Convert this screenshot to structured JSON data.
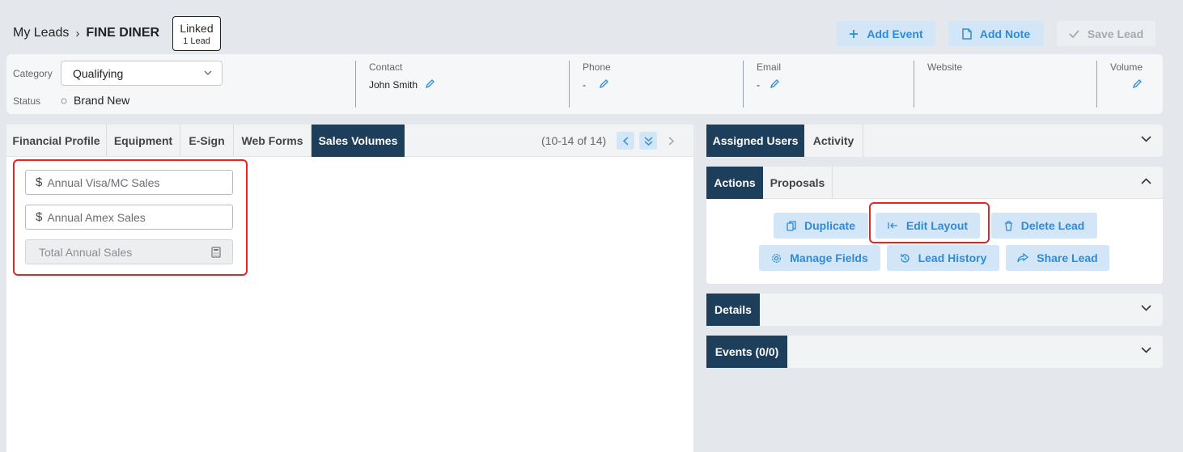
{
  "breadcrumb": {
    "root": "My Leads",
    "separator": "›",
    "current": "FINE DINER"
  },
  "linked_badge": {
    "title": "Linked",
    "count": "1 Lead"
  },
  "header_actions": {
    "add_event": "Add Event",
    "add_note": "Add Note",
    "save_lead": "Save Lead"
  },
  "info": {
    "category_label": "Category",
    "category_value": "Qualifying",
    "status_label": "Status",
    "status_value": "Brand New",
    "contact_label": "Contact",
    "contact_value": "John Smith",
    "phone_label": "Phone",
    "phone_value": "-",
    "email_label": "Email",
    "email_value": "-",
    "website_label": "Website",
    "volume_label": "Volume"
  },
  "left_tabs": [
    "Financial Profile",
    "Equipment",
    "E-Sign",
    "Web Forms",
    "Sales Volumes"
  ],
  "pager": {
    "text": "(10-14 of 14)"
  },
  "sales_fields": {
    "visa_mc_placeholder": "Annual Visa/MC Sales",
    "amex_placeholder": "Annual Amex Sales",
    "total_placeholder": "Total Annual Sales",
    "currency_symbol": "$"
  },
  "panel_users": {
    "tabs": [
      "Assigned Users",
      "Activity"
    ]
  },
  "panel_actions": {
    "tabs": [
      "Actions",
      "Proposals"
    ],
    "buttons": {
      "duplicate": "Duplicate",
      "edit_layout": "Edit Layout",
      "delete_lead": "Delete Lead",
      "manage_fields": "Manage Fields",
      "lead_history": "Lead History",
      "share_lead": "Share Lead"
    }
  },
  "panel_details": {
    "title": "Details"
  },
  "panel_events": {
    "title": "Events (0/0)"
  },
  "colors": {
    "primary_dark": "#1e3f5c",
    "accent_blue": "#2d8bd9",
    "button_bg": "#d3e6f7",
    "highlight_red": "#e52525"
  }
}
